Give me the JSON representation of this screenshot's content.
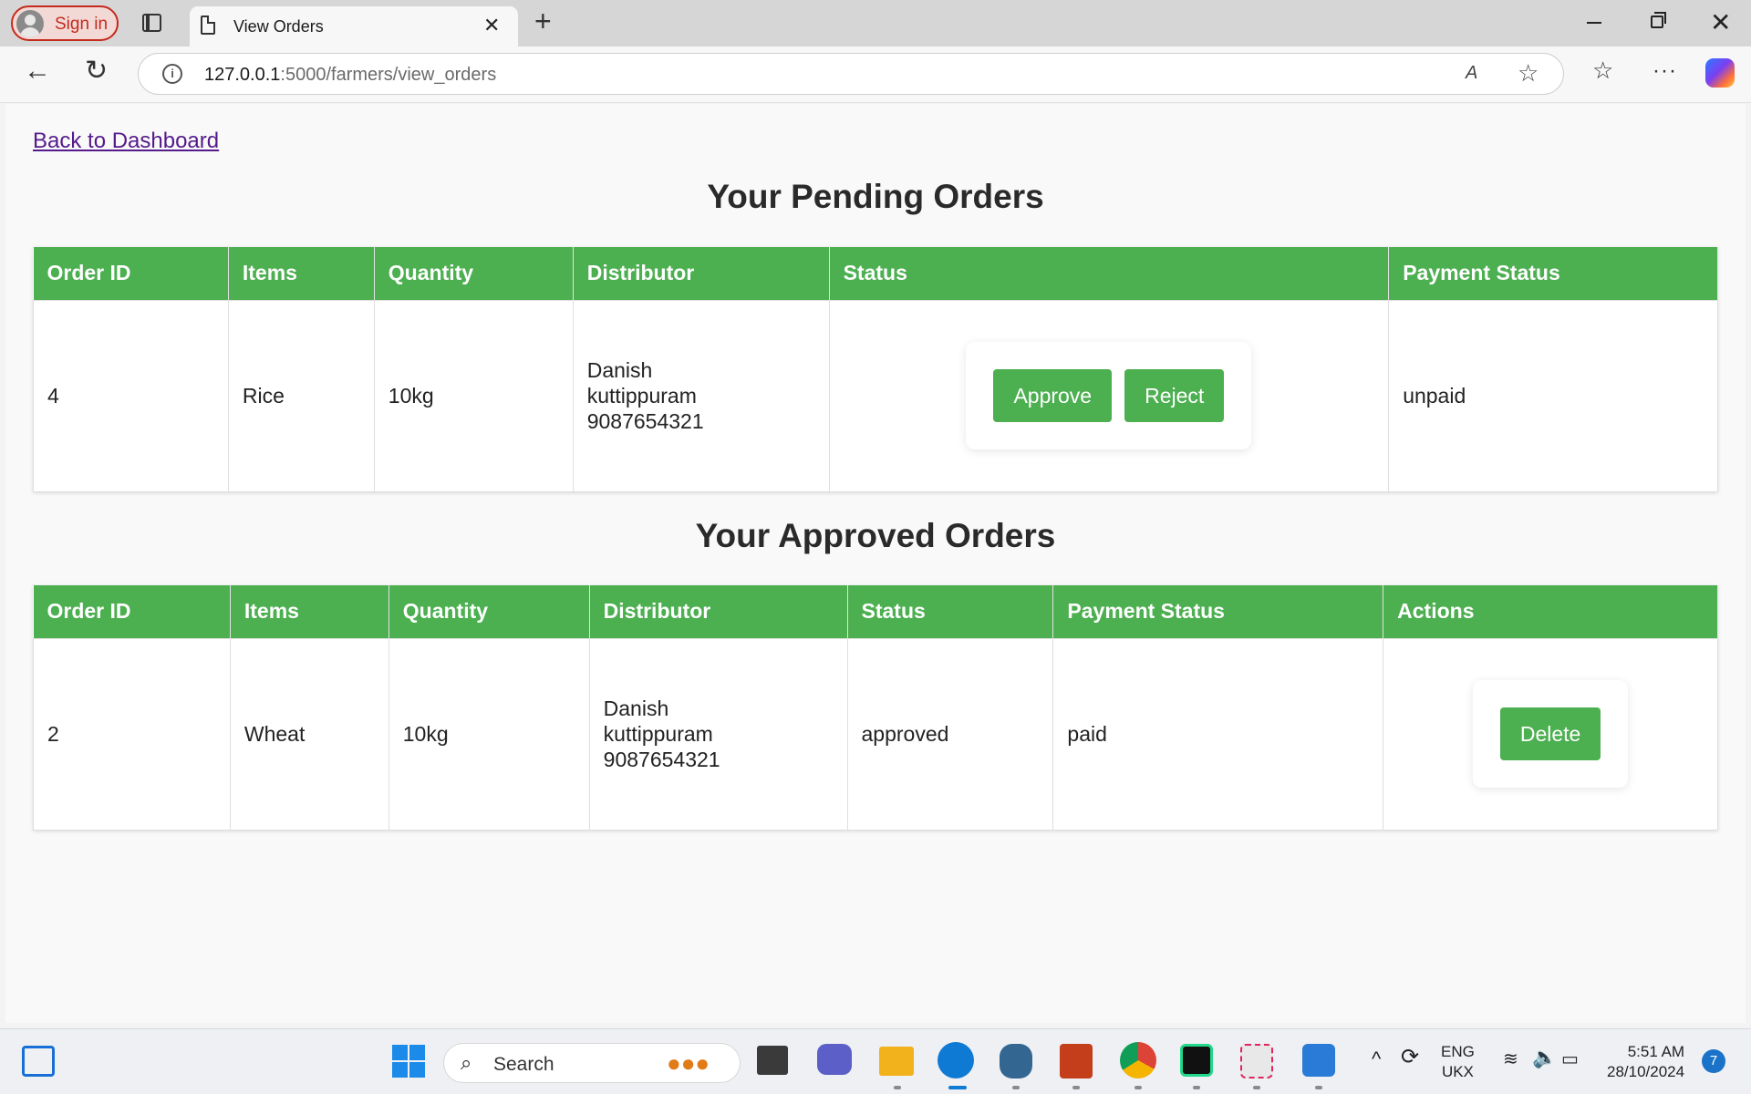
{
  "browser": {
    "sign_in_label": "Sign in",
    "tab_title": "View Orders",
    "url_host": "127.0.0.1",
    "url_rest": ":5000/farmers/view_orders"
  },
  "page": {
    "back_link": "Back to Dashboard",
    "pending_heading": "Your Pending Orders",
    "approved_heading": "Your Approved Orders"
  },
  "pending": {
    "columns": [
      "Order ID",
      "Items",
      "Quantity",
      "Distributor",
      "Status",
      "Payment Status"
    ],
    "rows": [
      {
        "order_id": "4",
        "items": "Rice",
        "quantity": "10kg",
        "distributor_name": "Danish",
        "distributor_place": "kuttippuram",
        "distributor_phone": "9087654321",
        "approve_label": "Approve",
        "reject_label": "Reject",
        "payment_status": "unpaid"
      }
    ]
  },
  "approved": {
    "columns": [
      "Order ID",
      "Items",
      "Quantity",
      "Distributor",
      "Status",
      "Payment Status",
      "Actions"
    ],
    "rows": [
      {
        "order_id": "2",
        "items": "Wheat",
        "quantity": "10kg",
        "distributor_name": "Danish",
        "distributor_place": "kuttippuram",
        "distributor_phone": "9087654321",
        "status": "approved",
        "payment_status": "paid",
        "delete_label": "Delete"
      }
    ]
  },
  "taskbar": {
    "search_placeholder": "Search",
    "lang_top": "ENG",
    "lang_bottom": "UKX",
    "time": "5:51 AM",
    "date": "28/10/2024",
    "notification_count": "7"
  },
  "colors": {
    "accent_green": "#4caf50",
    "link_purple": "#551a8b"
  }
}
